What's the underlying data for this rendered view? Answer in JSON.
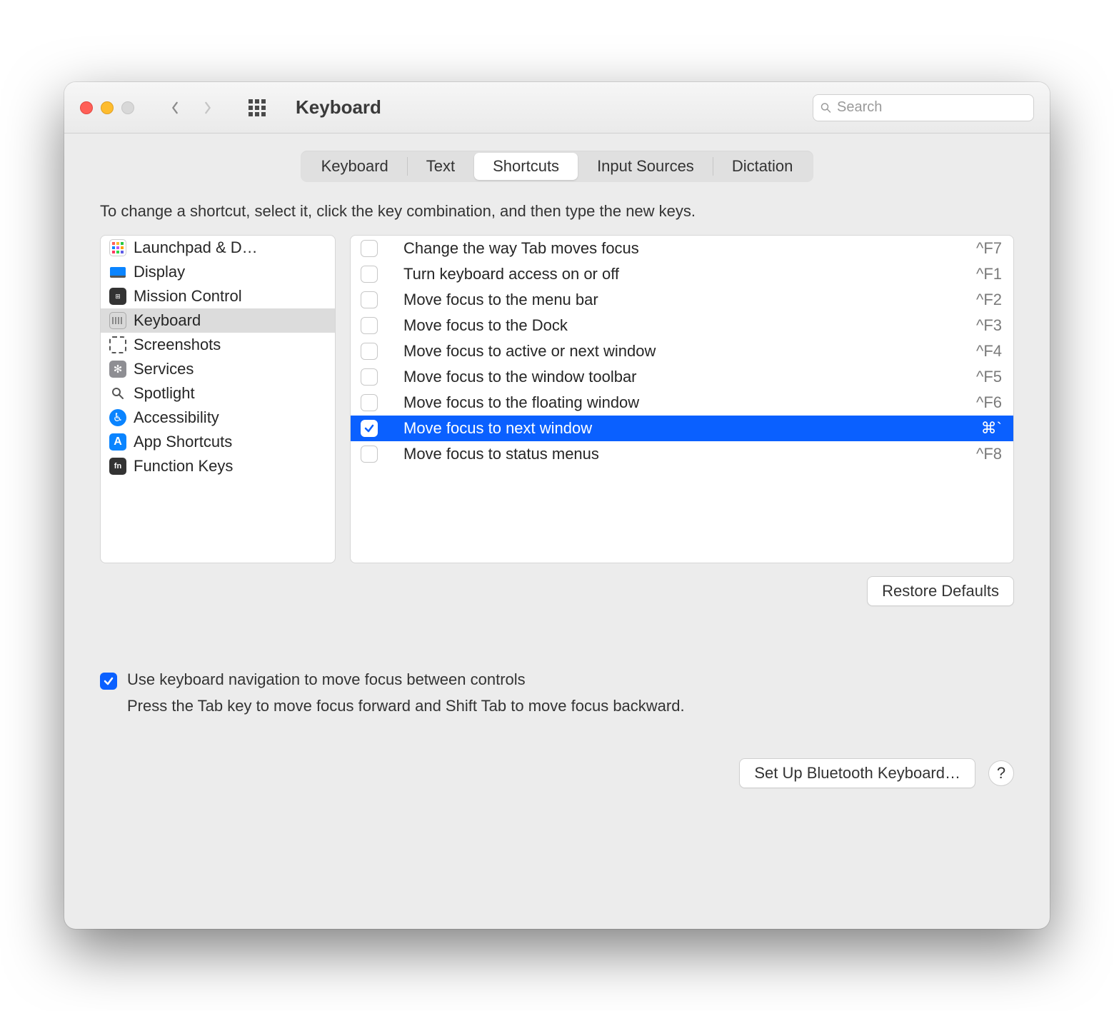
{
  "window": {
    "title": "Keyboard"
  },
  "search": {
    "placeholder": "Search"
  },
  "tabs": [
    {
      "label": "Keyboard"
    },
    {
      "label": "Text"
    },
    {
      "label": "Shortcuts"
    },
    {
      "label": "Input Sources"
    },
    {
      "label": "Dictation"
    }
  ],
  "active_tab": 2,
  "hint": "To change a shortcut, select it, click the key combination, and then type the new keys.",
  "categories": [
    {
      "label": "Launchpad & D…",
      "icon": "launchpad"
    },
    {
      "label": "Display",
      "icon": "display"
    },
    {
      "label": "Mission Control",
      "icon": "mission"
    },
    {
      "label": "Keyboard",
      "icon": "keyboard",
      "selected": true
    },
    {
      "label": "Screenshots",
      "icon": "screenshot"
    },
    {
      "label": "Services",
      "icon": "services"
    },
    {
      "label": "Spotlight",
      "icon": "spotlight"
    },
    {
      "label": "Accessibility",
      "icon": "accessibility"
    },
    {
      "label": "App Shortcuts",
      "icon": "apps"
    },
    {
      "label": "Function Keys",
      "icon": "fn"
    }
  ],
  "shortcuts": [
    {
      "enabled": false,
      "label": "Change the way Tab moves focus",
      "key": "^F7"
    },
    {
      "enabled": false,
      "label": "Turn keyboard access on or off",
      "key": "^F1"
    },
    {
      "enabled": false,
      "label": "Move focus to the menu bar",
      "key": "^F2"
    },
    {
      "enabled": false,
      "label": "Move focus to the Dock",
      "key": "^F3"
    },
    {
      "enabled": false,
      "label": "Move focus to active or next window",
      "key": "^F4"
    },
    {
      "enabled": false,
      "label": "Move focus to the window toolbar",
      "key": "^F5"
    },
    {
      "enabled": false,
      "label": "Move focus to the floating window",
      "key": "^F6"
    },
    {
      "enabled": true,
      "label": "Move focus to next window",
      "key": "⌘`",
      "selected": true
    },
    {
      "enabled": false,
      "label": "Move focus to status menus",
      "key": "^F8"
    }
  ],
  "restore_label": "Restore Defaults",
  "kbnav": {
    "enabled": true,
    "label": "Use keyboard navigation to move focus between controls",
    "sub": "Press the Tab key to move focus forward and Shift Tab to move focus backward."
  },
  "bluetooth_label": "Set Up Bluetooth Keyboard…",
  "help_label": "?"
}
